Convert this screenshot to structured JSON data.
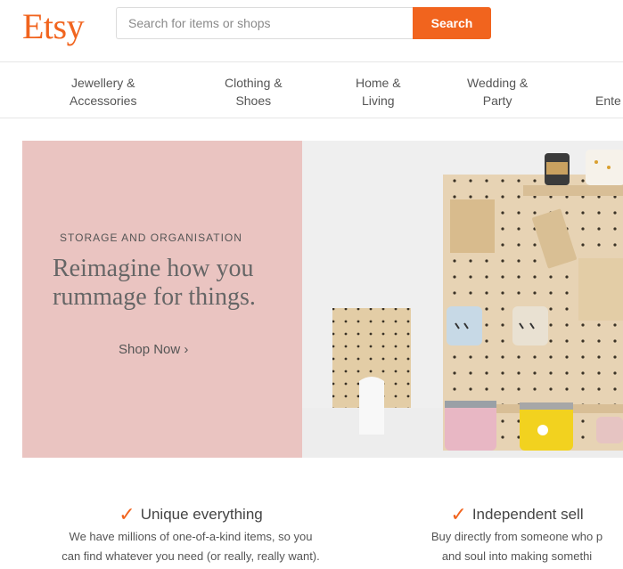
{
  "header": {
    "logo": "Etsy",
    "search_placeholder": "Search for items or shops",
    "search_button": "Search"
  },
  "nav": {
    "items": [
      {
        "label": "Jewellery &\nAccessories"
      },
      {
        "label": "Clothing &\nShoes"
      },
      {
        "label": "Home &\nLiving"
      },
      {
        "label": "Wedding &\nParty"
      },
      {
        "label": "Ente"
      }
    ]
  },
  "hero": {
    "eyebrow": "STORAGE AND ORGANISATION",
    "title": "Reimagine how you\nrummage for things.",
    "cta": "Shop Now ›",
    "carousel": {
      "count": 3,
      "active_index": 0
    },
    "colors": {
      "panel": "#eac4c1",
      "image_bg": "#efefef"
    }
  },
  "value_props": [
    {
      "icon": "check-icon",
      "title": "Unique everything",
      "body": "We have millions of one-of-a-kind items, so you\ncan find whatever you need (or really, really want)."
    },
    {
      "icon": "check-icon",
      "title": "Independent sell",
      "body": "Buy directly from someone who p\nand soul into making somethi"
    }
  ],
  "colors": {
    "brand": "#f1641e"
  }
}
